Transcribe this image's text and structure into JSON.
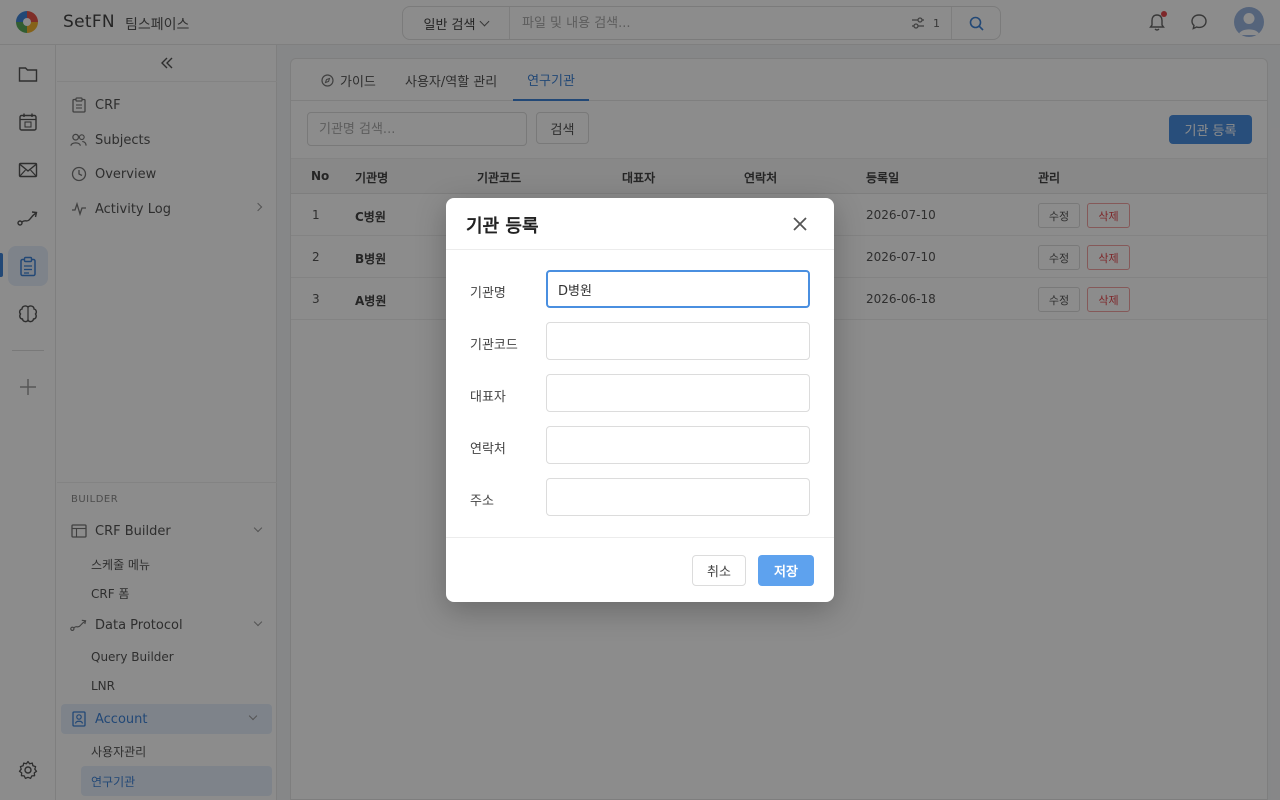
{
  "header": {
    "brand": "SetFN",
    "workspace": "팀스페이스",
    "search_type": "일반 검색",
    "search_placeholder": "파일 및 내용 검색...",
    "filter_count": "1"
  },
  "sidebar": {
    "items": [
      {
        "label": "CRF"
      },
      {
        "label": "Subjects"
      },
      {
        "label": "Overview"
      },
      {
        "label": "Activity Log"
      }
    ],
    "section_label": "BUILDER",
    "groups": [
      {
        "label": "CRF Builder",
        "children": [
          "스케줄 메뉴",
          "CRF 폼"
        ]
      },
      {
        "label": "Data Protocol",
        "children": [
          "Query Builder",
          "LNR"
        ]
      },
      {
        "label": "Account",
        "children": [
          "사용자관리",
          "연구기관"
        ]
      }
    ]
  },
  "main": {
    "tabs": [
      {
        "label": "가이드"
      },
      {
        "label": "사용자/역할 관리"
      },
      {
        "label": "연구기관",
        "active": true
      }
    ],
    "search_placeholder": "기관명 검색...",
    "search_button": "검색",
    "register_button": "기관 등록",
    "table": {
      "columns": [
        "No",
        "기관명",
        "기관코드",
        "대표자",
        "연락처",
        "등록일",
        "관리"
      ],
      "rows": [
        {
          "no": "1",
          "name": "C병원",
          "date": "2026-07-10"
        },
        {
          "no": "2",
          "name": "B병원",
          "date": "2026-07-10"
        },
        {
          "no": "3",
          "name": "A병원",
          "date": "2026-06-18"
        }
      ],
      "edit_label": "수정",
      "delete_label": "삭제"
    }
  },
  "modal": {
    "title": "기관 등록",
    "fields": [
      {
        "label": "기관명",
        "value": "D병원"
      },
      {
        "label": "기관코드",
        "value": ""
      },
      {
        "label": "대표자",
        "value": ""
      },
      {
        "label": "연락처",
        "value": ""
      },
      {
        "label": "주소",
        "value": ""
      }
    ],
    "cancel_label": "취소",
    "save_label": "저장"
  },
  "colors": {
    "accent": "#3f83d8",
    "danger": "#e5484d",
    "save": "#5ea2ee"
  }
}
